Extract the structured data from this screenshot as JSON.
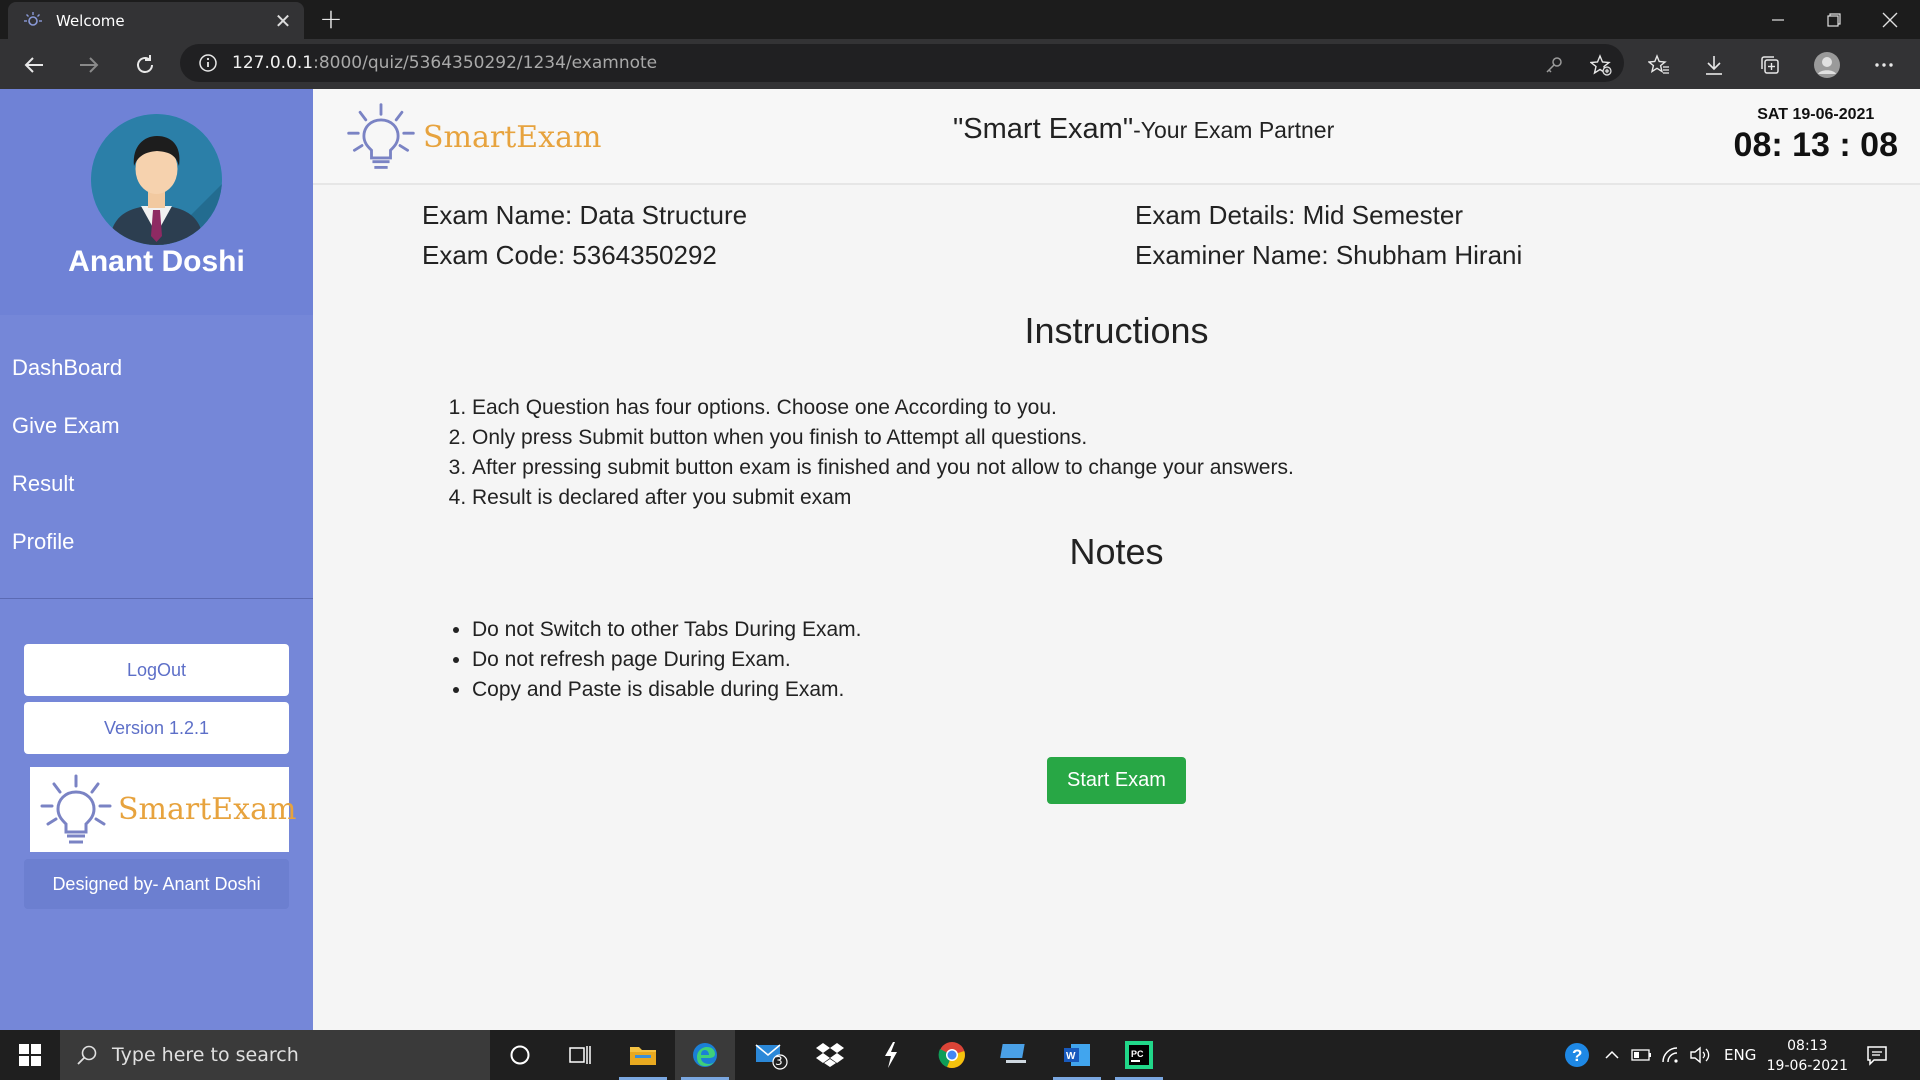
{
  "browser": {
    "tab_title": "Welcome",
    "url_host": "127.0.0.1",
    "url_rest": ":8000/quiz/5364350292/1234/examnote"
  },
  "sidebar": {
    "username": "Anant Doshi",
    "menu": [
      "DashBoard",
      "Give Exam",
      "Result",
      "Profile"
    ],
    "logout_label": "LogOut",
    "version_label": "Version 1.2.1",
    "logo_text": "SmartExam",
    "designed_by": "Designed by- Anant Doshi"
  },
  "header": {
    "brand": "SmartExam",
    "slogan_main": "\"Smart Exam\"",
    "slogan_sub": "-Your Exam Partner",
    "date": "SAT 19-06-2021",
    "clock": "08: 13 : 08"
  },
  "exam": {
    "name": "Exam Name: Data Structure",
    "code": "Exam Code: 5364350292",
    "details": "Exam Details: Mid Semester",
    "examiner": "Examiner Name: Shubham Hirani"
  },
  "instructions": {
    "heading": "Instructions",
    "items": [
      "Each Question has four options. Choose one According to you.",
      "Only press Submit button when you finish to Attempt all questions.",
      "After pressing submit button exam is finished and you not allow to change your answers.",
      "Result is declared after you submit exam"
    ]
  },
  "notes": {
    "heading": "Notes",
    "items": [
      "Do not Switch to other Tabs During Exam.",
      "Do not refresh page During Exam.",
      "Copy and Paste is disable during Exam."
    ]
  },
  "start_button": "Start Exam",
  "taskbar": {
    "search_placeholder": "Type here to search",
    "mail_badge": "3",
    "lang": "ENG",
    "time": "08:13",
    "date": "19-06-2021"
  },
  "colors": {
    "sidebar": "#7587d8",
    "accent_green": "#28a745",
    "logo_orange": "#e7a33e"
  }
}
